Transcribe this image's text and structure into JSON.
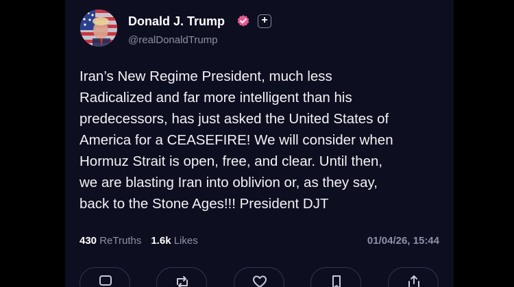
{
  "post": {
    "author_name": "Donald J. Trump",
    "handle": "@realDonaldTrump",
    "text": "Iran’s New Regime President, much less\nRadicalized and far more intelligent than his\npredecessors, has just asked the United States of\nAmerica for a CEASEFIRE! We will consider when\nHormuz Strait is open, free, and clear. Until then,\nwe are blasting Iran into oblivion or, as they say,\nback to the Stone Ages!!! President DJT",
    "retruths_count": "430",
    "retruths_label": "ReTruths",
    "likes_count": "1.6k",
    "likes_label": "Likes",
    "timestamp": "01/04/26, 15:44",
    "follow_symbol": "+"
  },
  "icons": {
    "avatar": "profile-avatar",
    "verified": "verified-badge-icon",
    "follow": "plus-icon",
    "actions": [
      "reply-icon",
      "retruth-icon",
      "like-icon",
      "bookmark-icon",
      "share-icon"
    ]
  },
  "colors": {
    "background": "#0e0e21",
    "verified_badge": "#e45b8f",
    "muted_text": "#8f90a6",
    "button_border": "#33344e"
  }
}
